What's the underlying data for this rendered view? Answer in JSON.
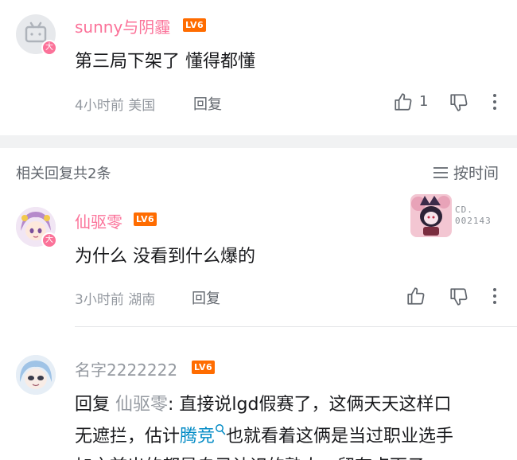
{
  "comment_main": {
    "username": "sunny与阴霾",
    "level": "LV6",
    "badge": "大",
    "text": "第三局下架了 懂得都懂",
    "time_location": "4小时前 美国",
    "reply_label": "回复",
    "like_count": "1"
  },
  "replies_header": {
    "title": "相关回复共2条",
    "sort_label": "按时间"
  },
  "reply1": {
    "username": "仙驱零",
    "level": "LV6",
    "badge": "大",
    "text": "为什么 没看到什么爆的",
    "time_location": "3小时前 湖南",
    "reply_label": "回复",
    "sticker_text_1": "CD.",
    "sticker_text_2": "002143"
  },
  "reply2": {
    "username": "名字2222222",
    "level": "LV6",
    "reply_prefix": "回复 ",
    "mention": "仙驱零",
    "line1_rest": ": 直接说lgd假赛了，这俩天天这样口",
    "line2_a": "无遮拦，估计",
    "line2_link": "腾竞",
    "line2_b": "也就看着这俩是当过职业选手",
    "line3": "加之前出的都是自己认识的熟人，留有点面子"
  },
  "colors": {
    "accent_pink": "#fb7299",
    "level_orange": "#ff6c00",
    "link_blue": "#008ac5",
    "meta_gray": "#9499a0"
  }
}
